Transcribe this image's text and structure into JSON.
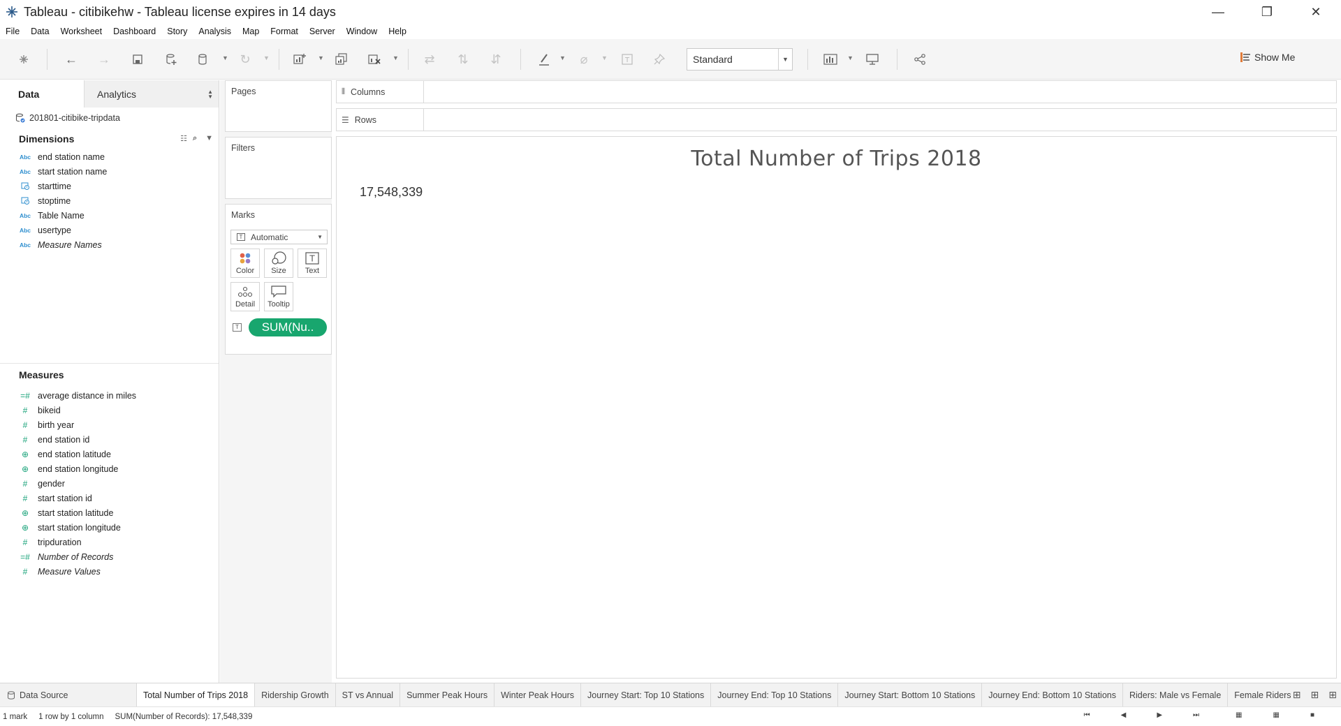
{
  "window": {
    "title": "Tableau - citibikehw - Tableau license expires in 14 days",
    "minimize": "—",
    "restore": "❐",
    "close": "✕"
  },
  "menu": [
    "File",
    "Data",
    "Worksheet",
    "Dashboard",
    "Story",
    "Analysis",
    "Map",
    "Format",
    "Server",
    "Window",
    "Help"
  ],
  "toolbar": {
    "fit_select": "Standard",
    "show_me": "Show Me"
  },
  "datapane": {
    "tab_data": "Data",
    "tab_analytics": "Analytics",
    "datasource": "201801-citibike-tripdata",
    "dimensions_header": "Dimensions",
    "dimensions": [
      {
        "icon": "Abc",
        "label": "end station name"
      },
      {
        "icon": "Abc",
        "label": "start station name"
      },
      {
        "icon": "date",
        "label": "starttime"
      },
      {
        "icon": "date",
        "label": "stoptime"
      },
      {
        "icon": "Abc",
        "label": "Table Name"
      },
      {
        "icon": "Abc",
        "label": "usertype"
      },
      {
        "icon": "Abc",
        "label": "Measure Names"
      }
    ],
    "measures_header": "Measures",
    "measures": [
      {
        "icon": "calc",
        "label": "average distance in miles"
      },
      {
        "icon": "#",
        "label": "bikeid"
      },
      {
        "icon": "#",
        "label": "birth year"
      },
      {
        "icon": "#",
        "label": "end station id"
      },
      {
        "icon": "geo",
        "label": "end station latitude"
      },
      {
        "icon": "geo",
        "label": "end station longitude"
      },
      {
        "icon": "#",
        "label": "gender"
      },
      {
        "icon": "#",
        "label": "start station id"
      },
      {
        "icon": "geo",
        "label": "start station latitude"
      },
      {
        "icon": "geo",
        "label": "start station longitude"
      },
      {
        "icon": "#",
        "label": "tripduration"
      },
      {
        "icon": "calc",
        "label": "Number of Records"
      },
      {
        "icon": "#",
        "label": "Measure Values"
      }
    ]
  },
  "shelves": {
    "pages": "Pages",
    "filters": "Filters",
    "marks": "Marks",
    "marks_type": "Automatic",
    "marks_buttons": {
      "color": "Color",
      "size": "Size",
      "text": "Text",
      "detail": "Detail",
      "tooltip": "Tooltip"
    },
    "pill": "SUM(Nu..",
    "columns": "Columns",
    "rows": "Rows"
  },
  "view": {
    "title": "Total Number of Trips 2018",
    "value": "17,548,339"
  },
  "sheets": {
    "data_source": "Data Source",
    "tabs": [
      "Total Number of Trips 2018",
      "Ridership Growth",
      "ST vs Annual",
      "Summer Peak Hours",
      "Winter Peak Hours",
      "Journey Start: Top 10 Stations",
      "Journey End: Top 10 Stations",
      "Journey Start: Bottom 10 Stations",
      "Journey End: Bottom 10 Stations",
      "Riders: Male vs Female",
      "Female Ridership"
    ],
    "active_index": 0
  },
  "status": {
    "marks": "1 mark",
    "dims": "1 row by 1 column",
    "sum": "SUM(Number of Records): 17,548,339"
  }
}
